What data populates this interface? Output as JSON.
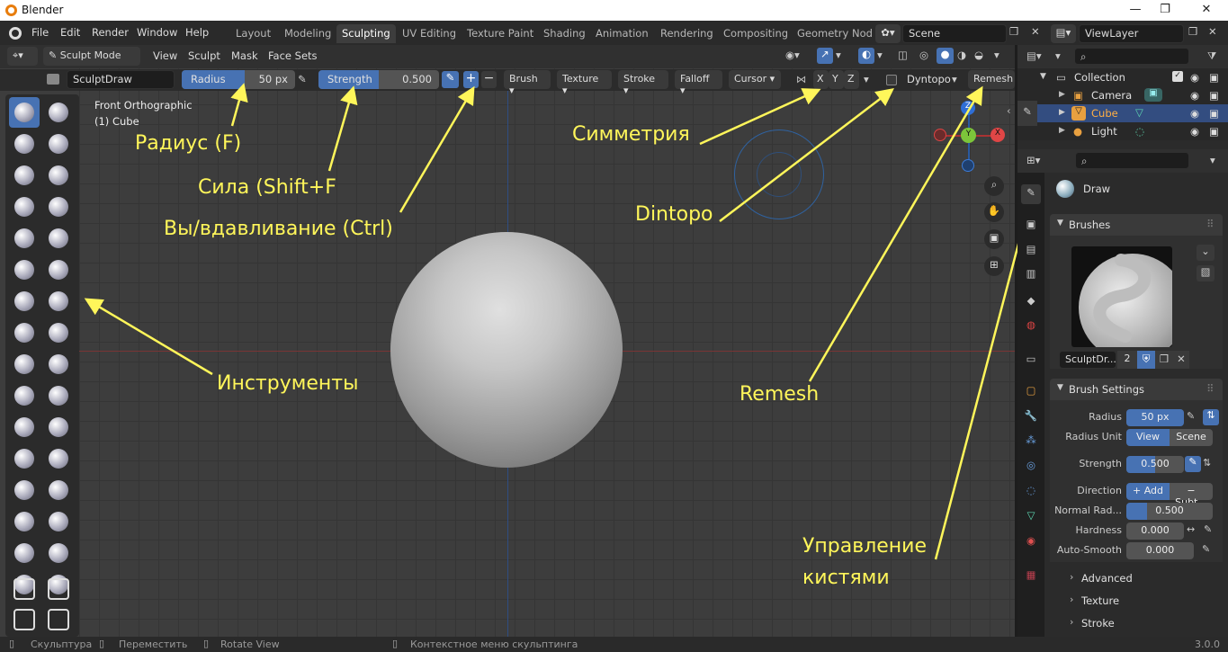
{
  "window": {
    "title": "Blender",
    "controls": [
      "—",
      "❐",
      "✕"
    ]
  },
  "menu": [
    "File",
    "Edit",
    "Render",
    "Window",
    "Help"
  ],
  "workspaces": [
    "Layout",
    "Modeling",
    "Sculpting",
    "UV Editing",
    "Texture Paint",
    "Shading",
    "Animation",
    "Rendering",
    "Compositing",
    "Geometry Nod"
  ],
  "active_workspace": "Sculpting",
  "scene": "Scene",
  "view_layer": "ViewLayer",
  "header": {
    "mode": "Sculpt Mode",
    "menus": [
      "View",
      "Sculpt",
      "Mask",
      "Face Sets"
    ]
  },
  "tool_header": {
    "brush_name": "SculptDraw",
    "radius_label": "Radius",
    "radius_value": "50 px",
    "strength_label": "Strength",
    "strength_value": "0.500",
    "plus": "+",
    "minus": "−",
    "dropdowns": [
      "Brush",
      "Texture",
      "Stroke",
      "Falloff",
      "Cursor"
    ],
    "axes": [
      "X",
      "Y",
      "Z"
    ],
    "dyntopo": "Dyntopo",
    "remesh": "Remesh"
  },
  "viewport": {
    "view_name": "Front Orthographic",
    "object_name": "(1) Cube",
    "gizmo_axes": [
      "Z",
      "Y",
      "X"
    ]
  },
  "annotations": {
    "radius": "Радиус (F)",
    "strength": "Сила (Shift+F",
    "direction": "Вы/вдавливание (Ctrl)",
    "symmetry": "Симметрия",
    "dintopo": "Dintopo",
    "tools": "Инструменты",
    "remesh": "Remesh",
    "brush_control_1": "Управление",
    "brush_control_2": "кистями"
  },
  "outliner": {
    "collection": "Collection",
    "items": [
      "Camera",
      "Cube",
      "Light"
    ],
    "selected": "Cube"
  },
  "properties": {
    "tool_name": "Draw",
    "brushes_panel": "Brushes",
    "brush_datablock": "SculptDr...",
    "brush_users": "2",
    "brush_settings_panel": "Brush Settings",
    "radius_label": "Radius",
    "radius_value": "50 px",
    "radius_unit_label": "Radius Unit",
    "radius_unit_view": "View",
    "radius_unit_scene": "Scene",
    "strength_label": "Strength",
    "strength_value": "0.500",
    "direction_label": "Direction",
    "direction_add": "+ Add",
    "direction_subtract": "− Subt...",
    "normal_radius_label": "Normal Rad...",
    "normal_radius_value": "0.500",
    "hardness_label": "Hardness",
    "hardness_value": "0.000",
    "autosmooth_label": "Auto-Smooth",
    "autosmooth_value": "0.000",
    "subpanels": [
      "Advanced",
      "Texture",
      "Stroke"
    ]
  },
  "statusbar": {
    "items": [
      "Скульптура",
      "Переместить",
      "Rotate View",
      "Контекстное меню скульптинга"
    ],
    "version": "3.0.0"
  },
  "colors": {
    "accent": "#4772b3",
    "annotation": "#fff65a",
    "viewport": "#3d3d3d"
  }
}
